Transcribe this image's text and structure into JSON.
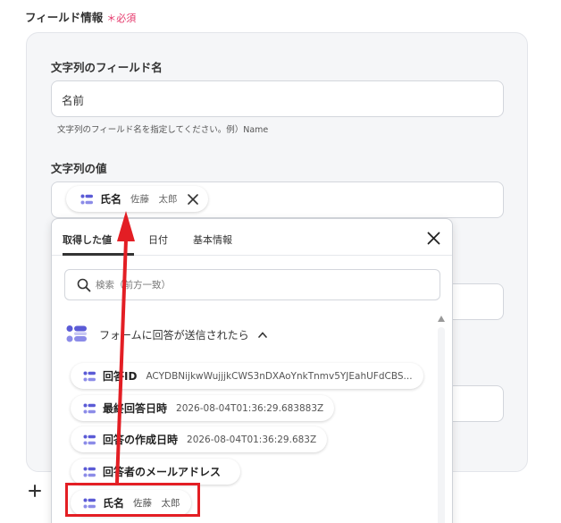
{
  "section": {
    "title": "フィールド情報",
    "required_mark": "＊必須"
  },
  "field_name": {
    "label": "文字列のフィールド名",
    "value": "名前",
    "help": "文字列のフィールド名を指定してください。例）Name"
  },
  "field_value": {
    "label": "文字列の値",
    "chip_name": "氏名",
    "chip_value": "佐藤　太郎"
  },
  "dropdown": {
    "tabs": [
      "取得した値",
      "日付",
      "基本情報"
    ],
    "search_placeholder": "検索（前方一致）",
    "group_label": "フォームに回答が送信されたら",
    "items": [
      {
        "name": "回答ID",
        "value": "ACYDBNijkwWujjjkCWS3nDXAoYnkTnmv5YJEahUFdCBS..."
      },
      {
        "name": "最終回答日時",
        "value": "2026-08-04T01:36:29.683883Z"
      },
      {
        "name": "回答の作成日時",
        "value": "2026-08-04T01:36:29.683Z"
      },
      {
        "name": "回答者のメールアドレス",
        "value": ""
      },
      {
        "name": "氏名",
        "value": "佐藤　太郎"
      }
    ]
  },
  "colors": {
    "accent_red": "#e31e24",
    "icon_purple": "#5b5bd6",
    "required_pink": "#e5386b"
  }
}
